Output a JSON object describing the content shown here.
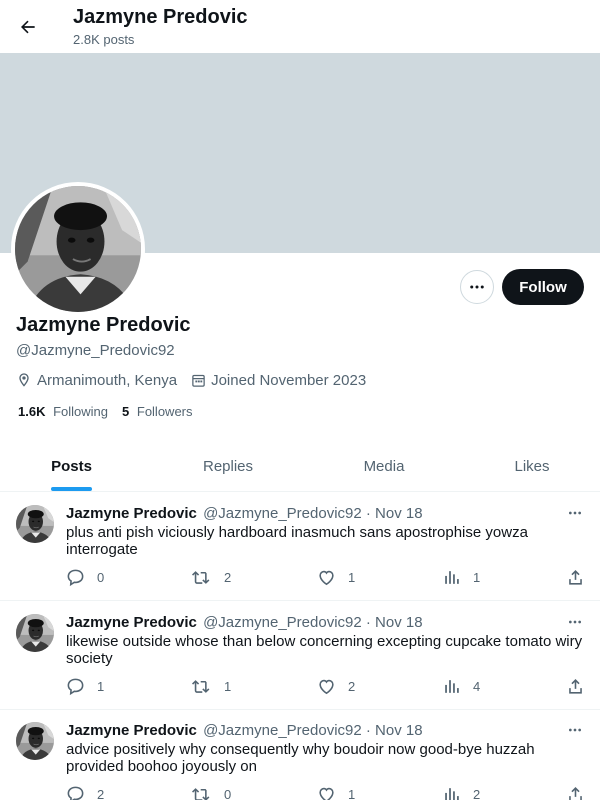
{
  "header": {
    "name": "Jazmyne Predovic",
    "post_count": "2.8K posts"
  },
  "profile": {
    "name": "Jazmyne Predovic",
    "handle": "@Jazmyne_Predovic92",
    "location": "Armanimouth, Kenya",
    "joined": "Joined November 2023",
    "following_count": "1.6K",
    "following_label": "Following",
    "followers_count": "5",
    "followers_label": "Followers",
    "follow_label": "Follow",
    "banner_color": "#cfd9de"
  },
  "tabs": [
    {
      "label": "Posts",
      "active": true
    },
    {
      "label": "Replies",
      "active": false
    },
    {
      "label": "Media",
      "active": false
    },
    {
      "label": "Likes",
      "active": false
    }
  ],
  "posts": [
    {
      "name": "Jazmyne Predovic",
      "handle_date": "@Jazmyne_Predovic92 · Nov 18",
      "text": "plus anti pish viciously hardboard inasmuch sans apostrophise yowza interrogate",
      "replies": "0",
      "reposts": "2",
      "likes": "1",
      "views": "1"
    },
    {
      "name": "Jazmyne Predovic",
      "handle_date": "@Jazmyne_Predovic92 · Nov 18",
      "text": "likewise outside whose than below concerning excepting cupcake tomato wiry society",
      "replies": "1",
      "reposts": "1",
      "likes": "2",
      "views": "4"
    },
    {
      "name": "Jazmyne Predovic",
      "handle_date": "@Jazmyne_Predovic92 · Nov 18",
      "text": "advice positively why consequently why boudoir now good-bye huzzah provided boohoo joyously on",
      "replies": "2",
      "reposts": "0",
      "likes": "1",
      "views": "2"
    }
  ],
  "colors": {
    "accent": "#1d9bf0",
    "text_primary": "#0f1419",
    "text_secondary": "#536471",
    "follow_button": "#0f1419"
  },
  "icons": [
    "back-arrow-icon",
    "more-icon",
    "location-icon",
    "calendar-icon",
    "reply-icon",
    "repost-icon",
    "like-icon",
    "views-icon",
    "share-icon"
  ]
}
